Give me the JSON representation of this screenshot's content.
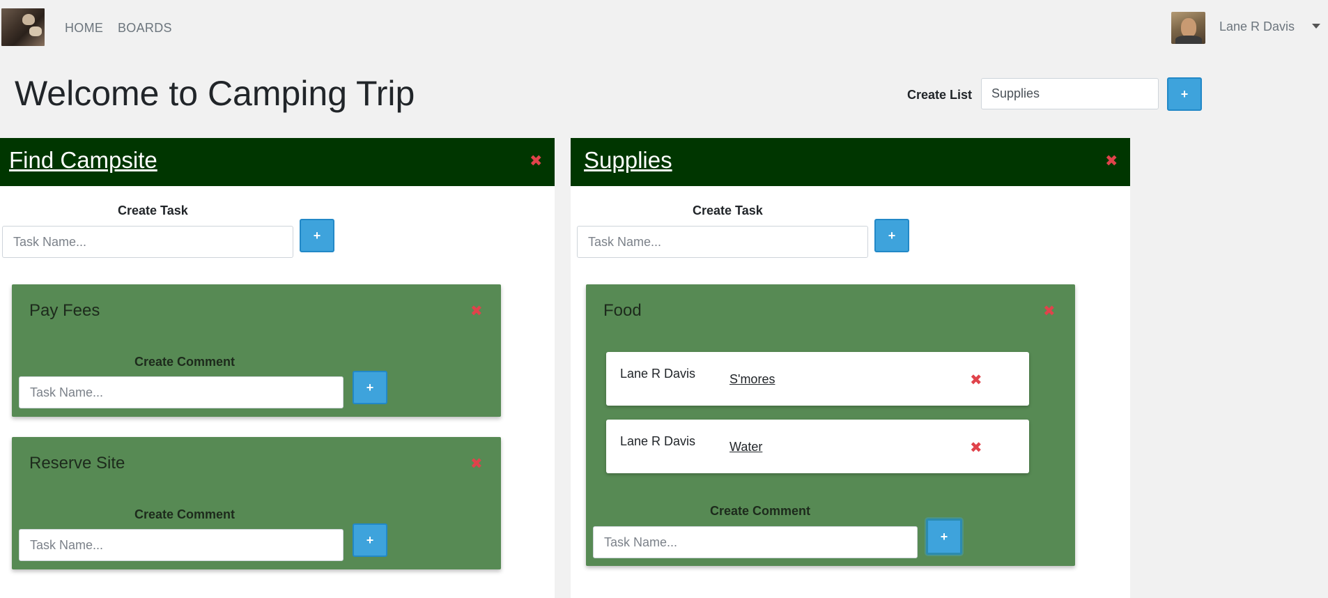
{
  "nav": {
    "home": "HOME",
    "boards": "BOARDS",
    "user_name": "Lane R Davis"
  },
  "header": {
    "title": "Welcome to Camping Trip",
    "create_list_label": "Create List",
    "create_list_value": "Supplies",
    "plus": "+"
  },
  "lists": [
    {
      "title": "Find Campsite",
      "close": "✖",
      "create_task_label": "Create Task",
      "task_placeholder": "Task Name...",
      "plus": "+",
      "tasks": [
        {
          "title": "Pay Fees",
          "close": "✖",
          "create_comment_label": "Create Comment",
          "comment_placeholder": "Task Name...",
          "plus": "+"
        },
        {
          "title": "Reserve Site",
          "close": "✖",
          "create_comment_label": "Create Comment",
          "comment_placeholder": "Task Name...",
          "plus": "+"
        }
      ]
    },
    {
      "title": "Supplies",
      "close": "✖",
      "create_task_label": "Create Task",
      "task_placeholder": "Task Name...",
      "plus": "+",
      "tasks": [
        {
          "title": "Food",
          "close": "✖",
          "comments": [
            {
              "author": "Lane R Davis",
              "text": "S'mores",
              "close": "✖"
            },
            {
              "author": "Lane R Davis",
              "text": "Water",
              "close": "✖"
            }
          ],
          "create_comment_label": "Create Comment",
          "comment_placeholder": "Task Name...",
          "plus": "+"
        }
      ]
    }
  ],
  "colors": {
    "background": "#f1f1f1",
    "list_header": "#003600",
    "task_card": "#578a54",
    "accent_button": "#3ea3dc",
    "delete": "#e0434b"
  }
}
